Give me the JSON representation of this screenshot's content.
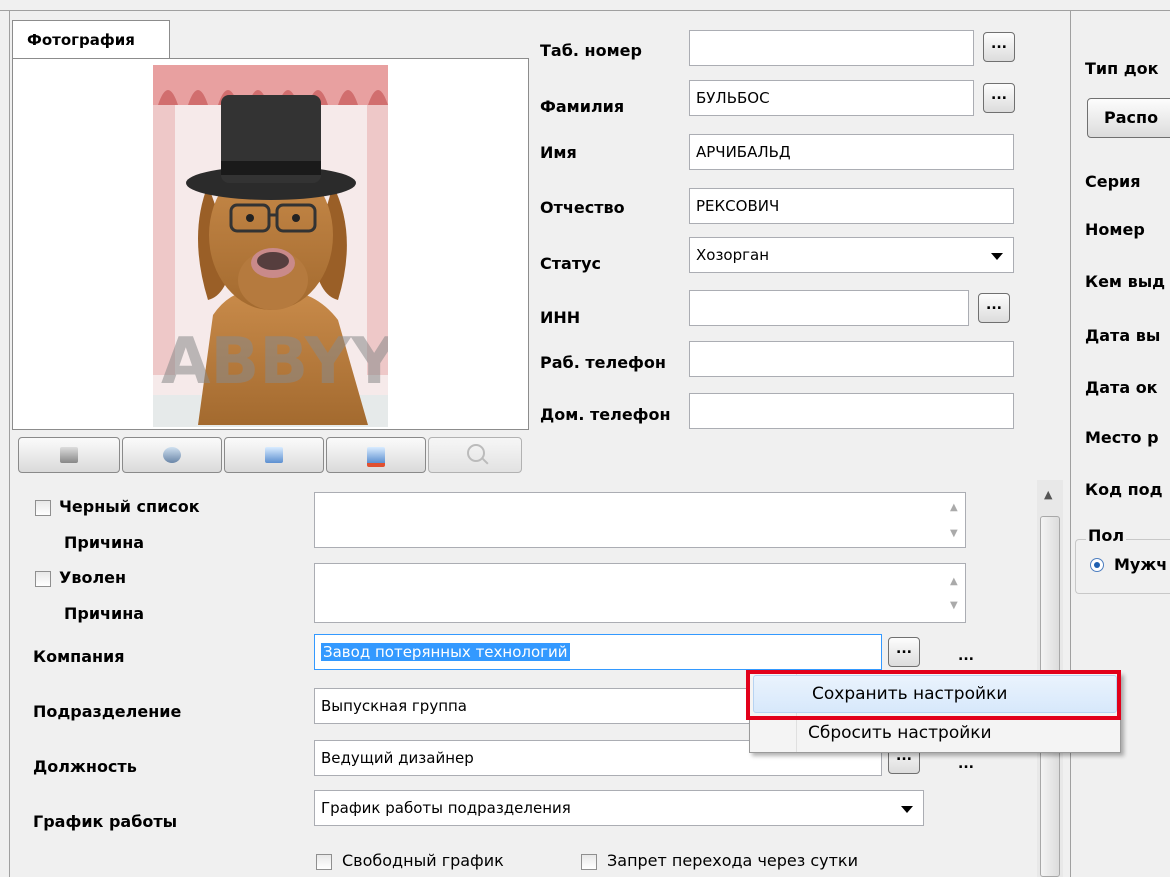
{
  "photo": {
    "tab_label": "Фотография",
    "watermark": "ABBYY"
  },
  "fields": {
    "tab_number": {
      "label": "Таб. номер",
      "value": ""
    },
    "last_name": {
      "label": "Фамилия",
      "value": "БУЛЬБОС"
    },
    "first_name": {
      "label": "Имя",
      "value": "АРЧИБАЛЬД"
    },
    "patronymic": {
      "label": "Отчество",
      "value": "РЕКСОВИЧ"
    },
    "status": {
      "label": "Статус",
      "value": "Хозорган"
    },
    "inn": {
      "label": "ИНН",
      "value": ""
    },
    "work_phone": {
      "label": "Раб. телефон",
      "value": ""
    },
    "home_phone": {
      "label": "Дом. телефон",
      "value": ""
    }
  },
  "blacklist": {
    "label": "Черный список",
    "reason_label": "Причина",
    "reason": ""
  },
  "fired": {
    "label": "Уволен",
    "reason_label": "Причина",
    "reason": ""
  },
  "company": {
    "label": "Компания",
    "value": "Завод потерянных технологий"
  },
  "department": {
    "label": "Подразделение",
    "value": "Выпускная группа"
  },
  "position": {
    "label": "Должность",
    "value": "Ведущий дизайнер"
  },
  "schedule": {
    "label": "График работы",
    "value": "График работы подразделения"
  },
  "free_schedule": {
    "label": "Свободный график"
  },
  "no_overnight": {
    "label": "Запрет перехода через сутки"
  },
  "ellipsis": "...",
  "right_panel": {
    "doc_type_label": "Тип док",
    "doc_button": "Распо",
    "series": "Серия",
    "number": "Номер",
    "issued_by": "Кем выд",
    "issue_date": "Дата вы",
    "expiry_date": "Дата ок",
    "birth_place": "Место р",
    "dept_code": "Код под",
    "gender_group": "Пол",
    "gender_male": "Мужч"
  },
  "context_menu": {
    "items": [
      "Сохранить настройки",
      "Сбросить настройки"
    ]
  },
  "colors": {
    "highlight": "#e2001a",
    "selection": "#3399ff"
  }
}
